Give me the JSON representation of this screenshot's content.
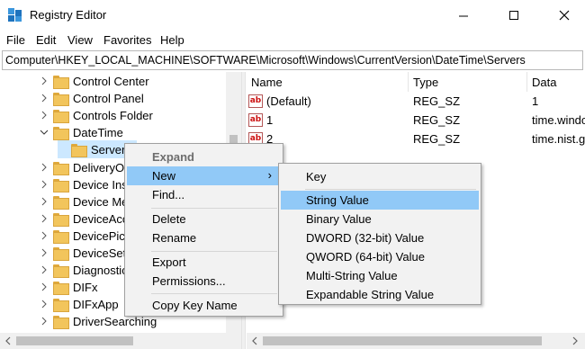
{
  "window": {
    "title": "Registry Editor",
    "minimize_glyph": "—",
    "maximize_glyph": "☐",
    "close_glyph": "✕"
  },
  "menubar": {
    "file": "File",
    "edit": "Edit",
    "view": "View",
    "favorites": "Favorites",
    "help": "Help"
  },
  "address": "Computer\\HKEY_LOCAL_MACHINE\\SOFTWARE\\Microsoft\\Windows\\CurrentVersion\\DateTime\\Servers",
  "tree": {
    "items": [
      {
        "label": "Control Center"
      },
      {
        "label": "Control Panel"
      },
      {
        "label": "Controls Folder"
      },
      {
        "label": "DateTime"
      },
      {
        "label": "Servers"
      },
      {
        "label": "DeliveryO"
      },
      {
        "label": "Device Ins"
      },
      {
        "label": "Device Me"
      },
      {
        "label": "DeviceAcc"
      },
      {
        "label": "DevicePick"
      },
      {
        "label": "DeviceSet"
      },
      {
        "label": "Diagnostic"
      },
      {
        "label": "DIFx"
      },
      {
        "label": "DIFxApp"
      },
      {
        "label": "DriverSearching"
      }
    ]
  },
  "list": {
    "headers": {
      "name": "Name",
      "type": "Type",
      "data": "Data"
    },
    "rows": [
      {
        "name": "(Default)",
        "type": "REG_SZ",
        "data": "1"
      },
      {
        "name": "1",
        "type": "REG_SZ",
        "data": "time.windows.com"
      },
      {
        "name": "2",
        "type": "REG_SZ",
        "data": "time.nist.gov"
      }
    ]
  },
  "context_menu": {
    "expand": "Expand",
    "new": "New",
    "find": "Find...",
    "delete": "Delete",
    "rename": "Rename",
    "export": "Export",
    "permissions": "Permissions...",
    "copy_key_name": "Copy Key Name",
    "submenu_arrow": "›"
  },
  "new_submenu": {
    "key": "Key",
    "string_value": "String Value",
    "binary_value": "Binary Value",
    "dword_value": "DWORD (32-bit) Value",
    "qword_value": "QWORD (64-bit) Value",
    "multi_string_value": "Multi-String Value",
    "expandable_string_value": "Expandable String Value"
  },
  "colors": {
    "highlight": "#91c9f7",
    "selected_tree": "#cce8ff"
  }
}
